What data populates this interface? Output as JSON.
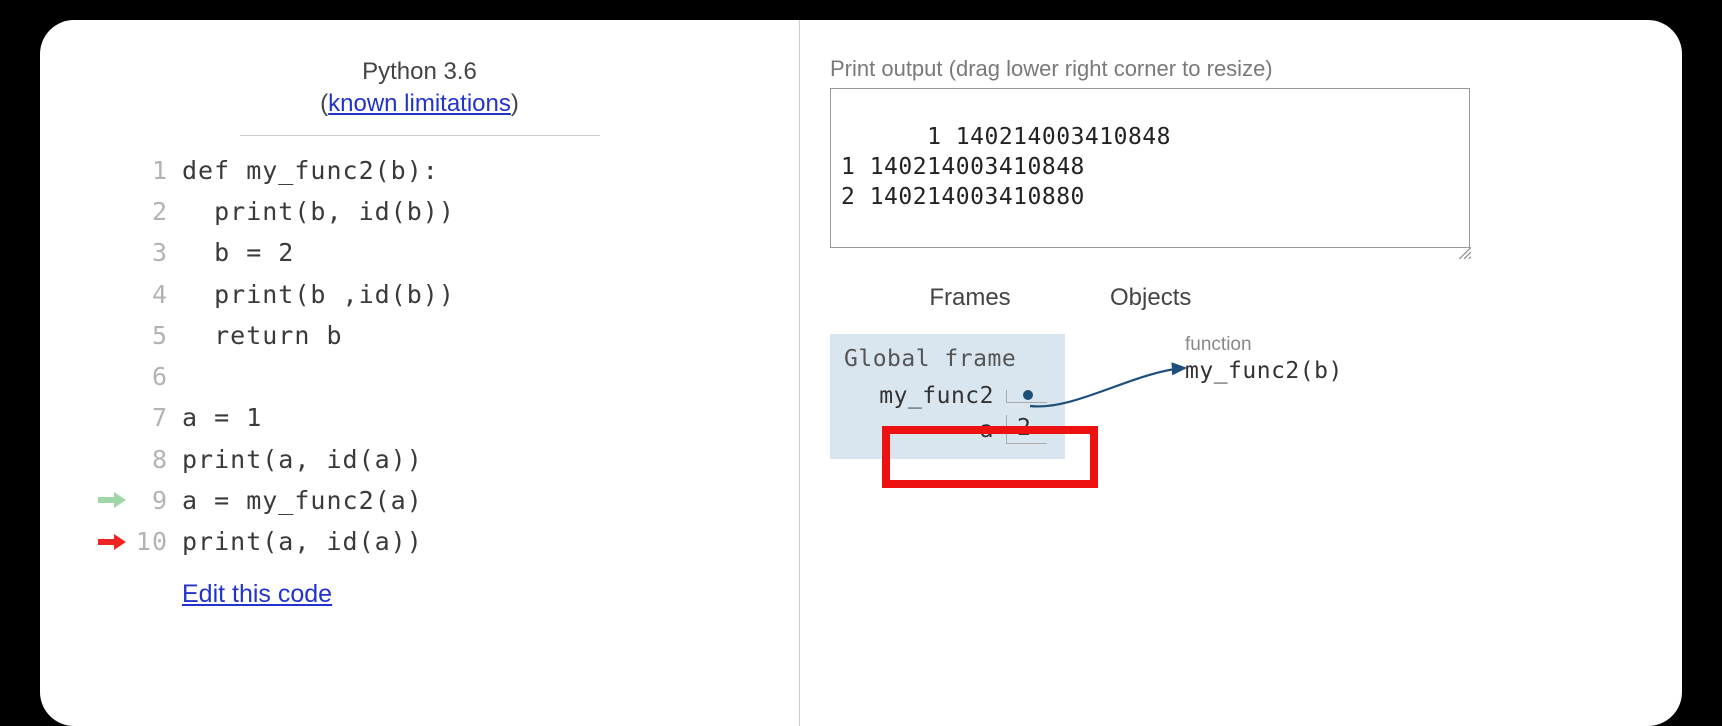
{
  "header": {
    "lang": "Python 3.6",
    "limitations_text": "known limitations"
  },
  "code": {
    "lines": [
      "def my_func2(b):",
      "  print(b, id(b))",
      "  b = 2",
      "  print(b ,id(b))",
      "  return b",
      "",
      "a = 1",
      "print(a, id(a))",
      "a = my_func2(a)",
      "print(a, id(a))"
    ],
    "prev_line": 9,
    "cur_line": 10,
    "edit_text": "Edit this code"
  },
  "output": {
    "label": "Print output (drag lower right corner to resize)",
    "lines": [
      "1 140214003410848",
      "1 140214003410848",
      "2 140214003410880"
    ]
  },
  "viz": {
    "frames_header": "Frames",
    "objects_header": "Objects",
    "frame_title": "Global frame",
    "vars": [
      {
        "name": "my_func2",
        "value": "",
        "is_pointer": true
      },
      {
        "name": "a",
        "value": "2",
        "is_pointer": false
      }
    ],
    "object_label": "function",
    "object_text": "my_func2(b)"
  }
}
